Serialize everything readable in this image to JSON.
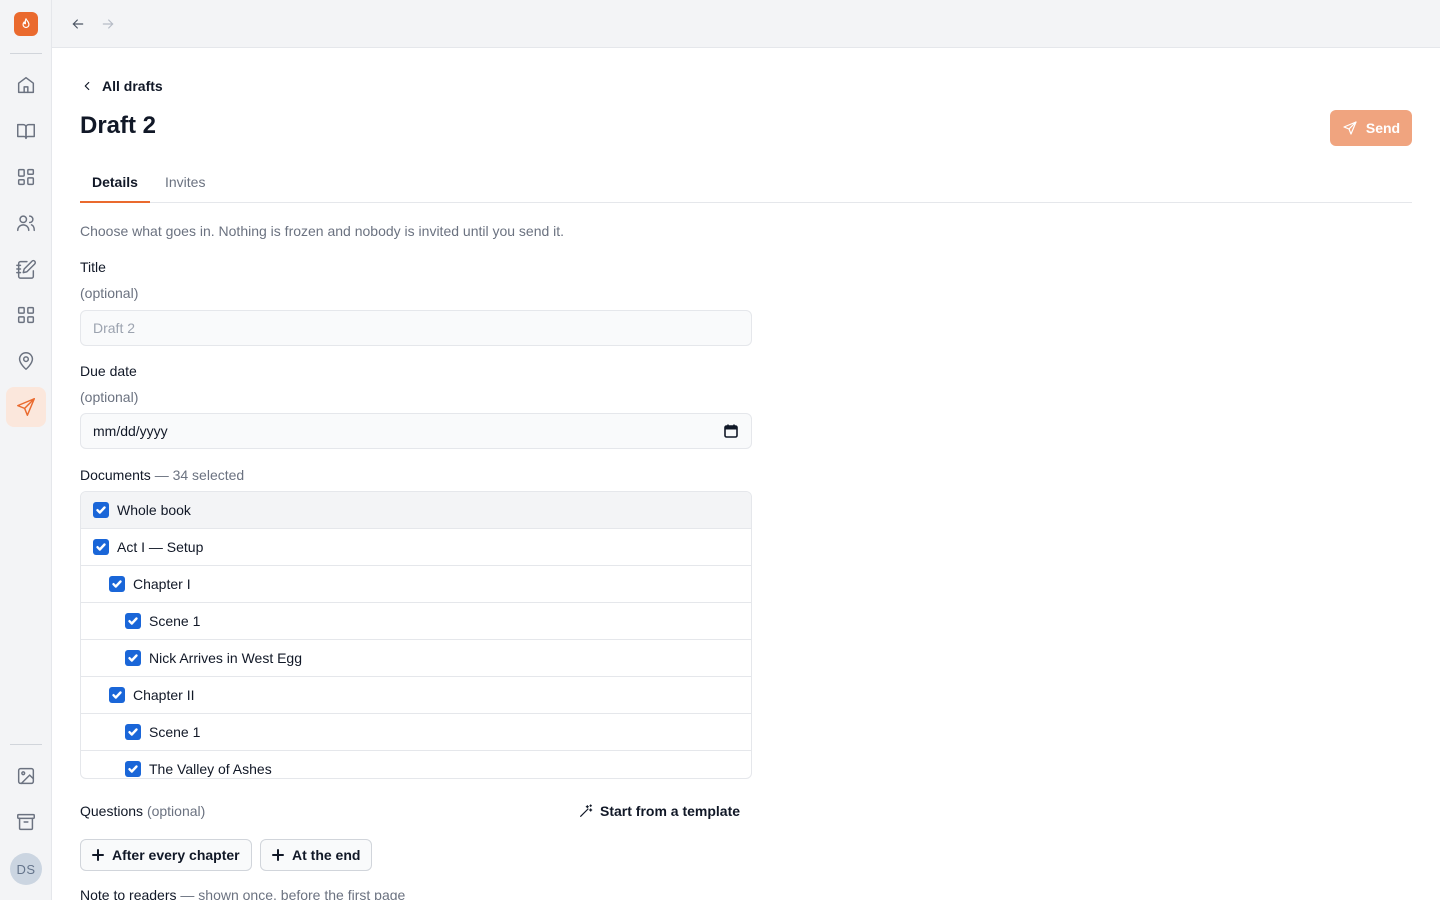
{
  "sidebar": {
    "logo_icon": "flame-icon",
    "items": [
      {
        "name": "home",
        "icon": "home-icon",
        "active": false
      },
      {
        "name": "library",
        "icon": "book-open-icon",
        "active": false
      },
      {
        "name": "dashboard",
        "icon": "layout-grid-icon",
        "active": false
      },
      {
        "name": "people",
        "icon": "users-icon",
        "active": false
      },
      {
        "name": "notebook",
        "icon": "notebook-pen-icon",
        "active": false
      },
      {
        "name": "apps",
        "icon": "grid-icon",
        "active": false
      },
      {
        "name": "locations",
        "icon": "map-pin-icon",
        "active": false
      },
      {
        "name": "drafts",
        "icon": "send-icon",
        "active": true
      }
    ],
    "bottom_items": [
      {
        "name": "images",
        "icon": "image-icon"
      },
      {
        "name": "archive",
        "icon": "archive-icon"
      }
    ],
    "avatar_initials": "DS"
  },
  "topbar": {
    "back_icon": "arrow-left-icon",
    "forward_icon": "arrow-right-icon"
  },
  "page": {
    "back_link": "All drafts",
    "title": "Draft 2",
    "send_label": "Send",
    "accent": "#ea6a2e"
  },
  "tabs": [
    {
      "label": "Details",
      "active": true
    },
    {
      "label": "Invites",
      "active": false
    }
  ],
  "form": {
    "intro": "Choose what goes in. Nothing is frozen and nobody is invited until you send it.",
    "title_label": "Title",
    "title_optional": "(optional)",
    "title_placeholder": "Draft 2",
    "due_label": "Due date",
    "due_optional": "(optional)",
    "due_value": "mm/dd/yyyy",
    "documents_label": "Documents",
    "documents_count": "— 34 selected",
    "documents": [
      {
        "label": "Whole book",
        "level": 0,
        "checked": true
      },
      {
        "label": "Act I — Setup",
        "level": 0,
        "checked": true
      },
      {
        "label": "Chapter I",
        "level": 1,
        "checked": true
      },
      {
        "label": "Scene 1",
        "level": 2,
        "checked": true
      },
      {
        "label": "Nick Arrives in West Egg",
        "level": 2,
        "checked": true
      },
      {
        "label": "Chapter II",
        "level": 1,
        "checked": true
      },
      {
        "label": "Scene 1",
        "level": 2,
        "checked": true
      },
      {
        "label": "The Valley of Ashes",
        "level": 2,
        "checked": true
      }
    ],
    "questions_label": "Questions",
    "questions_optional": "(optional)",
    "template_label": "Start from a template",
    "add_after_chapter": "After every chapter",
    "add_at_end": "At the end",
    "note_label": "Note to readers",
    "note_hint": "— shown once, before the first page"
  }
}
